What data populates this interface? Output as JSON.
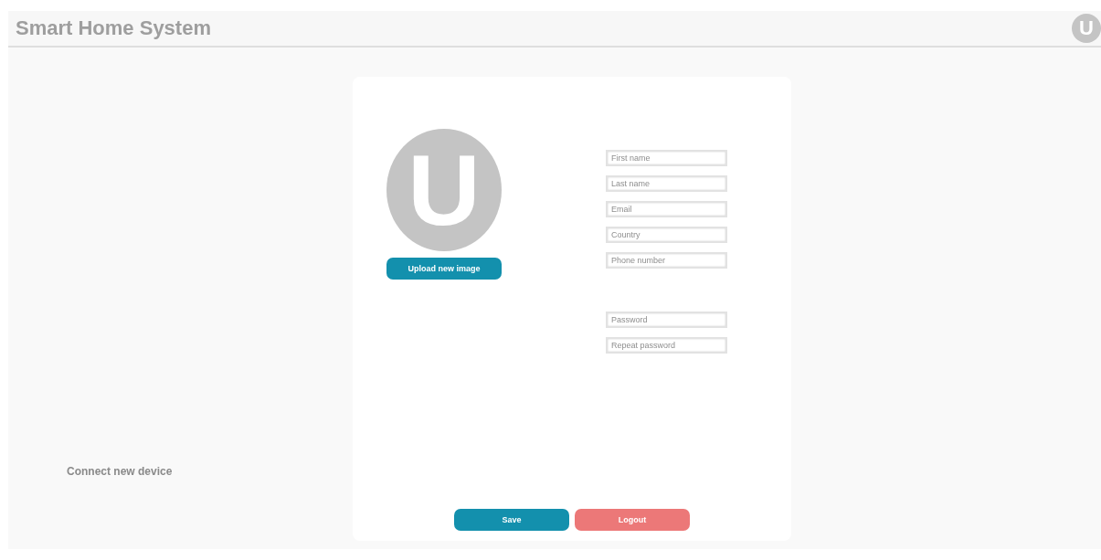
{
  "header": {
    "title": "Smart Home System",
    "avatar_letter": "U"
  },
  "sidebar": {
    "link": "Connect new device"
  },
  "profile": {
    "avatar_letter": "U",
    "upload_button": "Upload new image",
    "fields": [
      {
        "placeholder": "First name"
      },
      {
        "placeholder": "Last name"
      },
      {
        "placeholder": "Email"
      },
      {
        "placeholder": "Country"
      },
      {
        "placeholder": "Phone number"
      }
    ],
    "password_fields": [
      {
        "placeholder": "Password"
      },
      {
        "placeholder": "Repeat password"
      }
    ],
    "buttons": [
      {
        "label": "Save",
        "kind": "primary"
      },
      {
        "label": "Logout",
        "kind": "danger"
      }
    ]
  }
}
